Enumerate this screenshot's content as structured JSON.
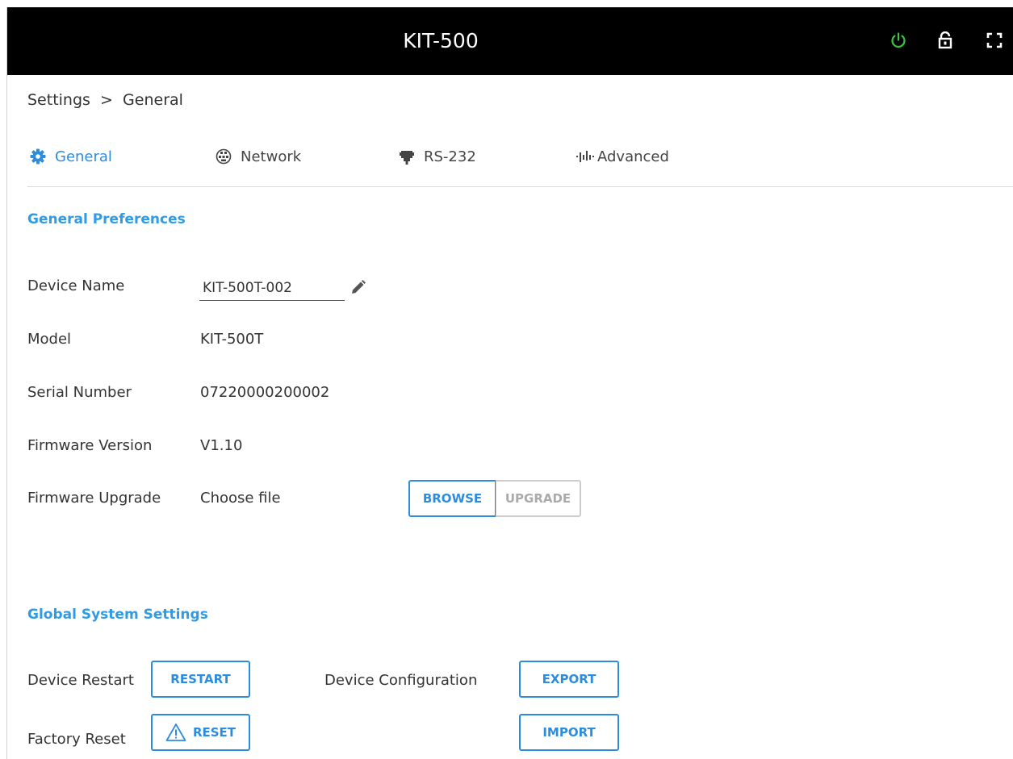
{
  "window": {
    "title": "KIT-500"
  },
  "toolbar": {
    "icons": [
      "power-icon",
      "lock-icon",
      "fullscreen-icon"
    ],
    "power_color": "#3cc43c"
  },
  "breadcrumb": {
    "parent": "Settings",
    "separator": ">",
    "current": "General"
  },
  "tabs": [
    {
      "label": "General",
      "icon": "gear-icon",
      "active": true
    },
    {
      "label": "Network",
      "icon": "network-icon",
      "active": false
    },
    {
      "label": "RS-232",
      "icon": "serial-port-icon",
      "active": false
    },
    {
      "label": "Advanced",
      "icon": "advanced-icon",
      "active": false
    }
  ],
  "general_preferences": {
    "title": "General Preferences",
    "device_name": {
      "label": "Device Name",
      "value": "KIT-500T-002"
    },
    "model": {
      "label": "Model",
      "value": "KIT-500T"
    },
    "serial_number": {
      "label": "Serial Number",
      "value": "07220000200002"
    },
    "firmware_version": {
      "label": "Firmware Version",
      "value": "V1.10"
    },
    "firmware_upgrade": {
      "label": "Firmware Upgrade",
      "file_text": "Choose file",
      "browse_label": "BROWSE",
      "upgrade_label": "UPGRADE",
      "upgrade_enabled": false
    }
  },
  "global_system_settings": {
    "title": "Global System Settings",
    "device_restart": {
      "label": "Device Restart",
      "button": "RESTART"
    },
    "factory_reset": {
      "label": "Factory Reset",
      "button": "RESET"
    },
    "device_configuration": {
      "label": "Device Configuration",
      "export_button": "EXPORT",
      "import_button": "IMPORT"
    }
  },
  "colors": {
    "accent": "#2e8cde",
    "section_title": "#2e9be6",
    "titlebar": "#000000",
    "disabled": "#aaaaaa"
  }
}
